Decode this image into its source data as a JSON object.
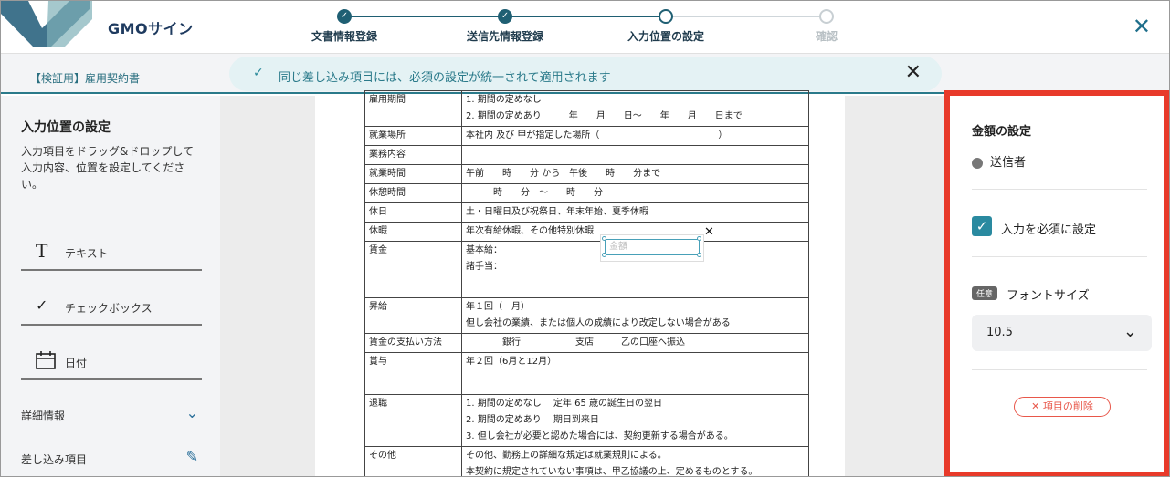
{
  "header": {
    "logo": "GMOサイン",
    "close_icon": "close-icon",
    "steps": [
      {
        "label": "文書情報登録",
        "state": "done"
      },
      {
        "label": "送信先情報登録",
        "state": "done"
      },
      {
        "label": "入力位置の設定",
        "state": "current"
      },
      {
        "label": "確認",
        "state": "todo"
      }
    ]
  },
  "subbar": {
    "doc_title": "【検証用】雇用契約書",
    "toast": "同じ差し込み項目には、必須の設定が統一されて適用されます"
  },
  "sidebar": {
    "title": "入力位置の設定",
    "description": "入力項目をドラッグ&ドロップして入力内容、位置を設定してください。",
    "fields": [
      {
        "label": "テキスト",
        "icon": "T"
      },
      {
        "label": "チェックボックス",
        "icon": "✓"
      },
      {
        "label": "日付",
        "icon": "calendar"
      }
    ],
    "details": "詳細情報",
    "merge_items": "差し込み項目"
  },
  "document": {
    "rows": [
      {
        "k": "雇用期間",
        "v": "1. 期間の定めなし\n2. 期間の定めあり　　　年　　月　　日～　　年　　月　　日まで"
      },
      {
        "k": "就業場所",
        "v": "本社内 及び 甲が指定した場所（　　　　　　　　　　　　　）"
      },
      {
        "k": "業務内容",
        "v": ""
      },
      {
        "k": "就業時間",
        "v": "午前　　時　　分 から　午後　　時　　分まで"
      },
      {
        "k": "休憩時間",
        "v": "　　　時　　分　～　　時　　分"
      },
      {
        "k": "休日",
        "v": "土・日曜日及び祝祭日、年末年始、夏季休暇"
      },
      {
        "k": "休暇",
        "v": "年次有給休暇、その他特別休暇"
      },
      {
        "k": "賃金",
        "v": "基本給：\n諸手当："
      },
      {
        "k": "昇給",
        "v": "年１回（　月）\n但し会社の業績、または個人の成績により改定しない場合がある"
      },
      {
        "k": "賃金の支払い方法",
        "v": "　　　　銀行　　　　　　支店　　　乙の口座へ振込"
      },
      {
        "k": "賞与",
        "v": "年２回（6月と12月）"
      },
      {
        "k": "退職",
        "v": "1. 期間の定めなし　 定年 65 歳の誕生日の翌日\n2. 期間の定めあり　 期日到来日\n3. 但し会社が必要と認めた場合には、契約更新する場合がある。"
      },
      {
        "k": "その他",
        "v": "その他、勤務上の詳細な規定は就業規則による。\n本契約に規定されていない事項は、甲乙協議の上、定めるものとする。"
      }
    ],
    "amount_placeholder": "金額"
  },
  "panel": {
    "title": "金額の設定",
    "sender": "送信者",
    "required_label": "入力を必須に設定",
    "badge": "任意",
    "font_label": "フォントサイズ",
    "font_value": "10.5",
    "delete": "✕ 項目の削除"
  },
  "colors": {
    "accent": "#2a7a8a",
    "highlight": "#e83a2a"
  }
}
